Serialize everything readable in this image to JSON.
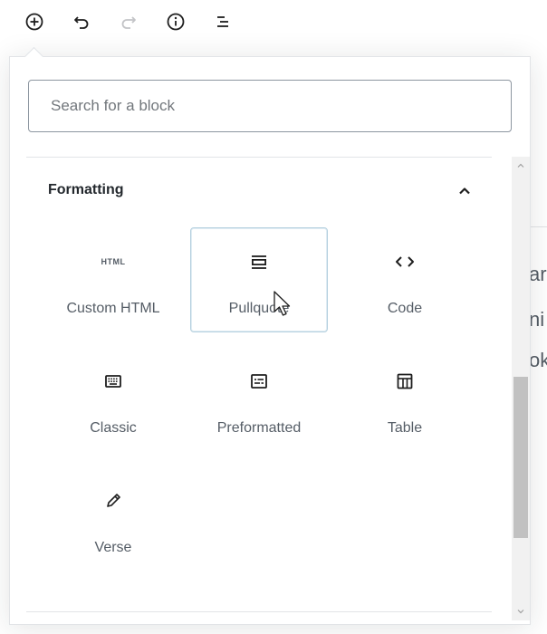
{
  "toolbar": {
    "icons": [
      "add-block-icon",
      "undo-icon",
      "redo-icon",
      "info-icon",
      "outline-icon"
    ]
  },
  "search": {
    "placeholder": "Search for a block"
  },
  "section": {
    "title": "Formatting",
    "toggle_icon": "chevron-up-icon"
  },
  "blocks": [
    {
      "label": "Custom HTML",
      "icon": "html-icon",
      "icon_text": "HTML"
    },
    {
      "label": "Pullquote",
      "icon": "pullquote-icon"
    },
    {
      "label": "Code",
      "icon": "code-icon"
    },
    {
      "label": "Classic",
      "icon": "keyboard-icon"
    },
    {
      "label": "Preformatted",
      "icon": "preformatted-icon"
    },
    {
      "label": "Table",
      "icon": "table-icon"
    },
    {
      "label": "Verse",
      "icon": "pencil-icon"
    }
  ],
  "background_peek": [
    "ar",
    "ni",
    "ok"
  ],
  "colors": {
    "border": "#e2e4e7",
    "text": "#555d66",
    "hover_border": "#b5d0df"
  }
}
